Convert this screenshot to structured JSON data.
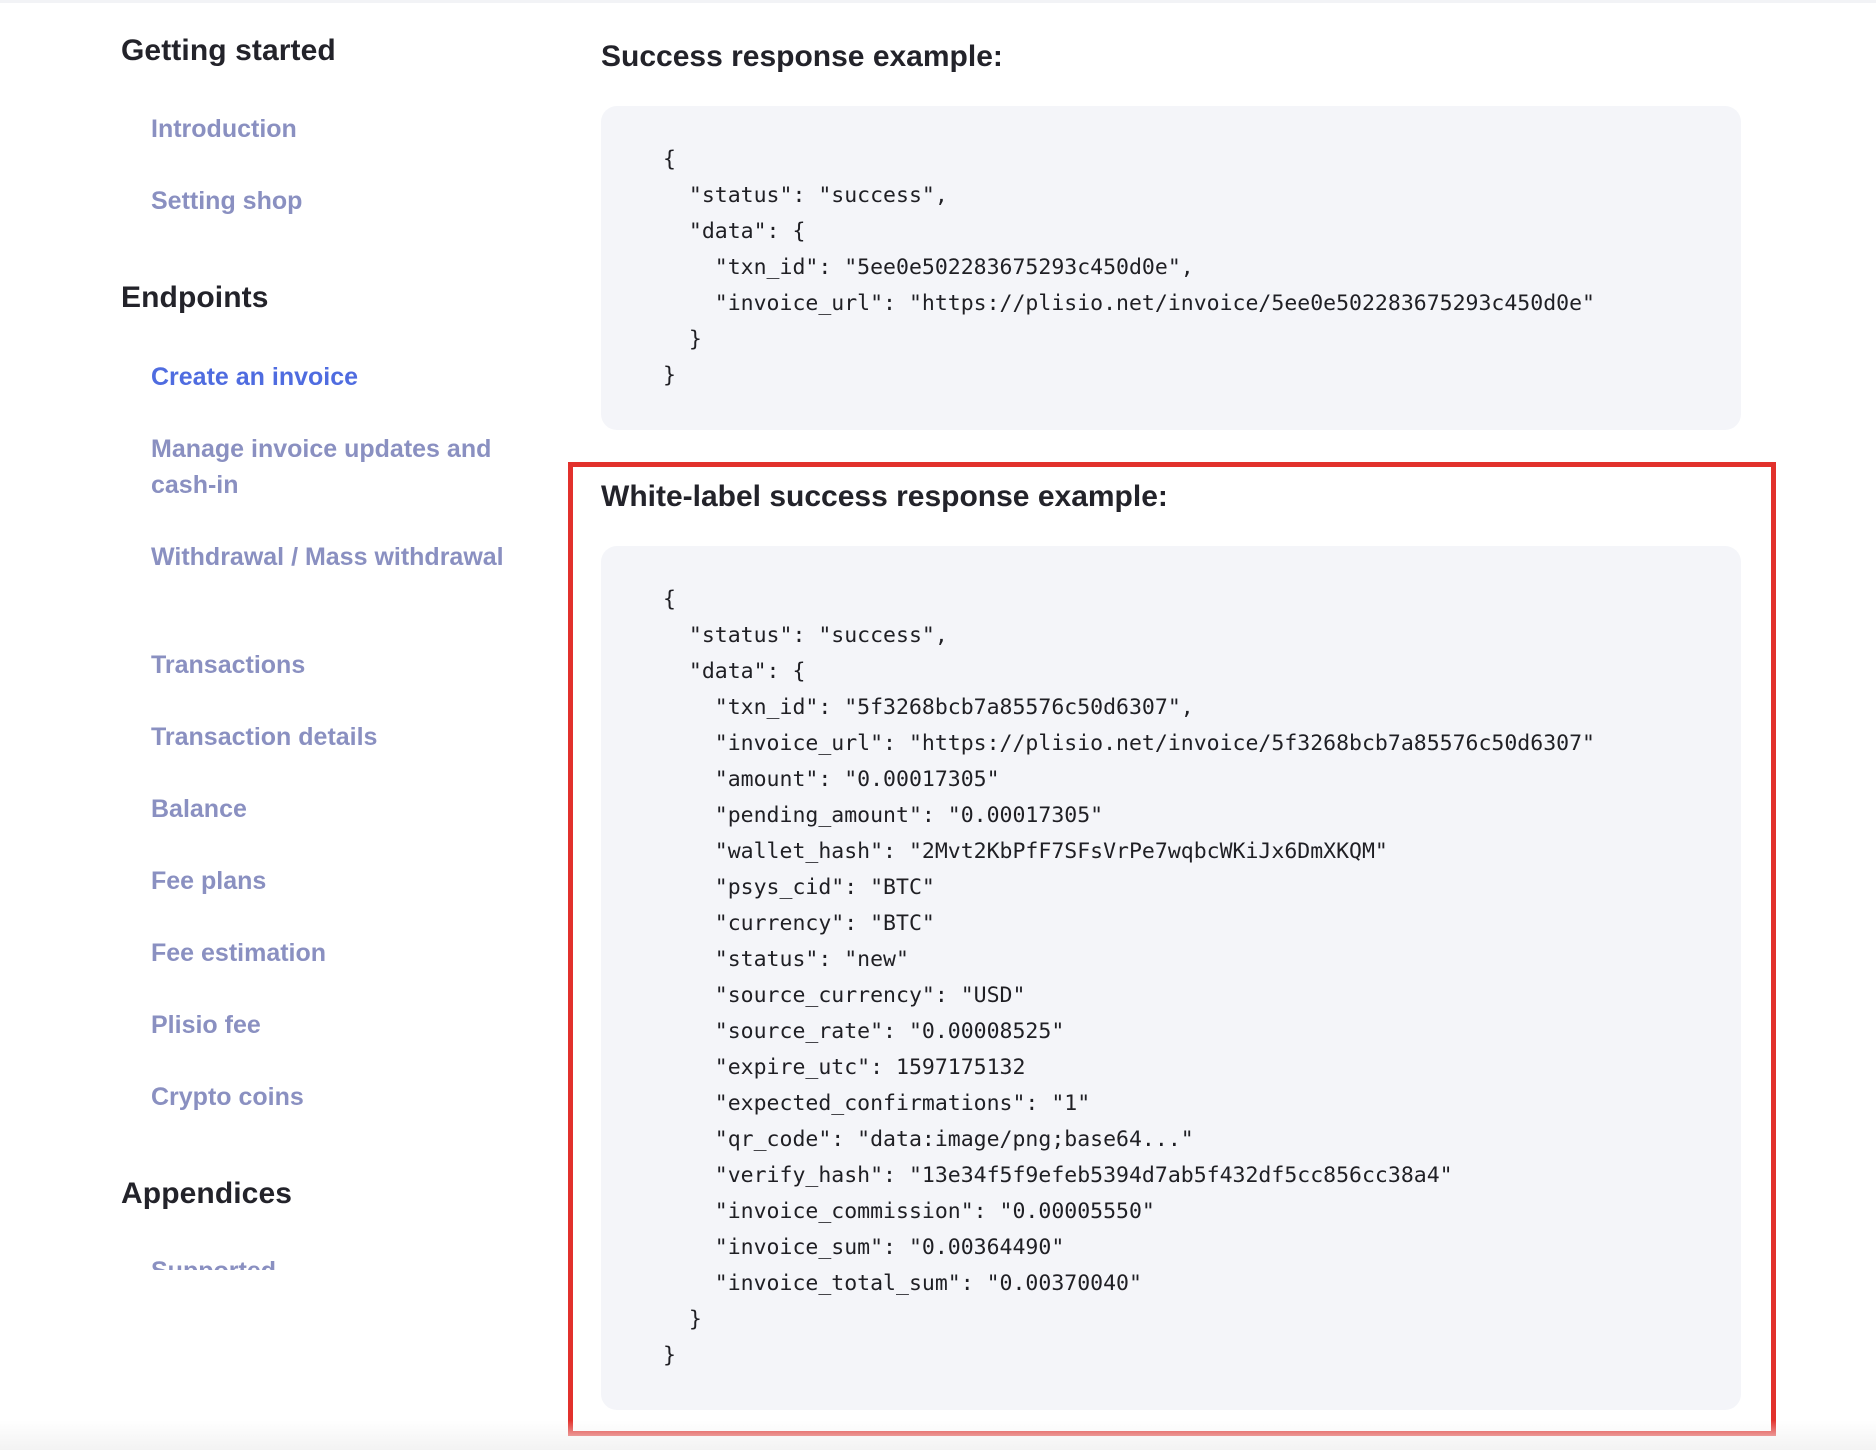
{
  "sidebar": {
    "sections": [
      {
        "title": "Getting started",
        "items": [
          "Introduction",
          "Setting shop"
        ]
      },
      {
        "title": "Endpoints",
        "items": [
          "Create an invoice",
          "Manage invoice updates and cash-in",
          "Withdrawal / Mass withdrawal",
          "Transactions",
          "Transaction details",
          "Balance",
          "Fee plans",
          "Fee estimation",
          "Plisio fee",
          "Crypto coins"
        ]
      },
      {
        "title": "Appendices",
        "items": [
          "Supported"
        ]
      }
    ],
    "active_item": "Create an invoice"
  },
  "main": {
    "success_heading": "Success response example:",
    "success_code": "{\n  \"status\": \"success\",\n  \"data\": {\n    \"txn_id\": \"5ee0e502283675293c450d0e\",\n    \"invoice_url\": \"https://plisio.net/invoice/5ee0e502283675293c450d0e\"\n  }\n}",
    "whitelabel_heading": "White-label success response example:",
    "whitelabel_code": "{\n  \"status\": \"success\",\n  \"data\": {\n    \"txn_id\": \"5f3268bcb7a85576c50d6307\",\n    \"invoice_url\": \"https://plisio.net/invoice/5f3268bcb7a85576c50d6307\"\n    \"amount\": \"0.00017305\"\n    \"pending_amount\": \"0.00017305\"\n    \"wallet_hash\": \"2Mvt2KbPfF7SFsVrPe7wqbcWKiJx6DmXKQM\"\n    \"psys_cid\": \"BTC\"\n    \"currency\": \"BTC\"\n    \"status\": \"new\"\n    \"source_currency\": \"USD\"\n    \"source_rate\": \"0.00008525\"\n    \"expire_utc\": 1597175132\n    \"expected_confirmations\": \"1\"\n    \"qr_code\": \"data:image/png;base64...\"\n    \"verify_hash\": \"13e34f5f9efeb5394d7ab5f432df5cc856cc38a4\"\n    \"invoice_commission\": \"0.00005550\"\n    \"invoice_sum\": \"0.00364490\"\n    \"invoice_total_sum\": \"0.00370040\"\n  }\n}"
  },
  "colors": {
    "link": "#8a90c1",
    "link_active": "#4f6ce0",
    "code_bg": "#f4f5f9",
    "highlight": "#e2312c"
  }
}
